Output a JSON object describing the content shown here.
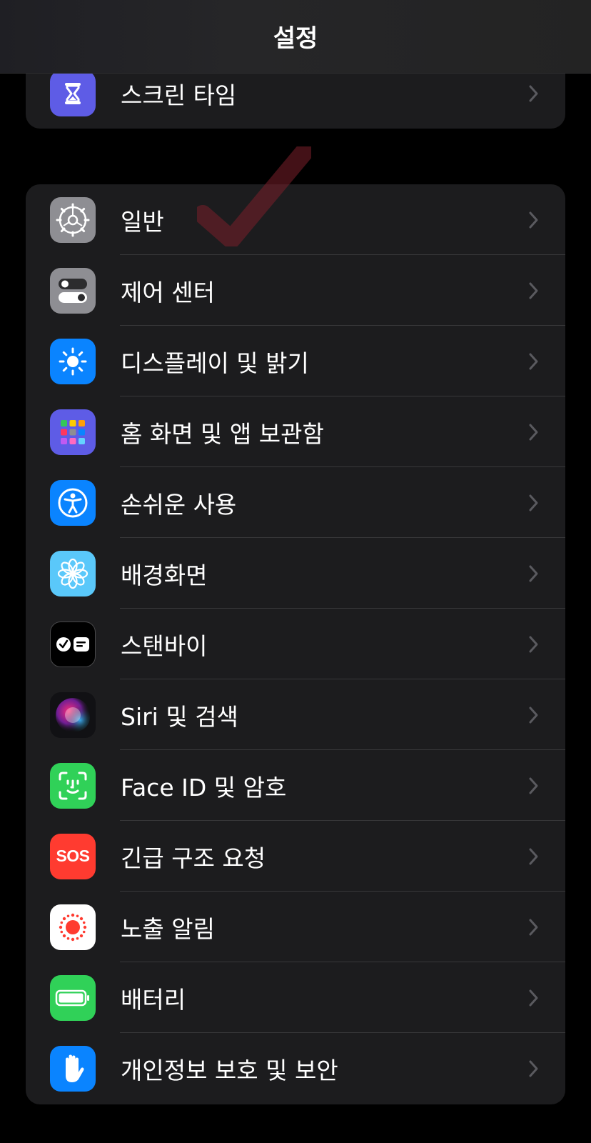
{
  "nav": {
    "title": "설정"
  },
  "top_group": {
    "items": [
      {
        "label": "스크린 타임",
        "icon": "hourglass-icon",
        "color": "#5e5ce6"
      }
    ]
  },
  "main_group": {
    "items": [
      {
        "label": "일반",
        "icon": "gear-icon",
        "color": "#8e8e93"
      },
      {
        "label": "제어 센터",
        "icon": "toggles-icon",
        "color": "#8e8e93"
      },
      {
        "label": "디스플레이 및 밝기",
        "icon": "sun-icon",
        "color": "#0a84ff"
      },
      {
        "label": "홈 화면 및 앱 보관함",
        "icon": "app-grid-icon",
        "color": "#5e5ce6"
      },
      {
        "label": "손쉬운 사용",
        "icon": "accessibility-icon",
        "color": "#0a84ff"
      },
      {
        "label": "배경화면",
        "icon": "flower-icon",
        "color": "#5ac8fa"
      },
      {
        "label": "스탠바이",
        "icon": "standby-icon",
        "color": "#000000"
      },
      {
        "label": "Siri 및 검색",
        "icon": "siri-icon",
        "color": "#1c1c1e"
      },
      {
        "label": "Face ID 및 암호",
        "icon": "face-id-icon",
        "color": "#30d158"
      },
      {
        "label": "긴급 구조 요청",
        "icon": "sos-icon",
        "color": "#ff3b30",
        "icon_text": "SOS"
      },
      {
        "label": "노출 알림",
        "icon": "exposure-icon",
        "color": "#ffffff"
      },
      {
        "label": "배터리",
        "icon": "battery-icon",
        "color": "#30d158"
      },
      {
        "label": "개인정보 보호 및 보안",
        "icon": "hand-icon",
        "color": "#0a84ff"
      }
    ]
  }
}
